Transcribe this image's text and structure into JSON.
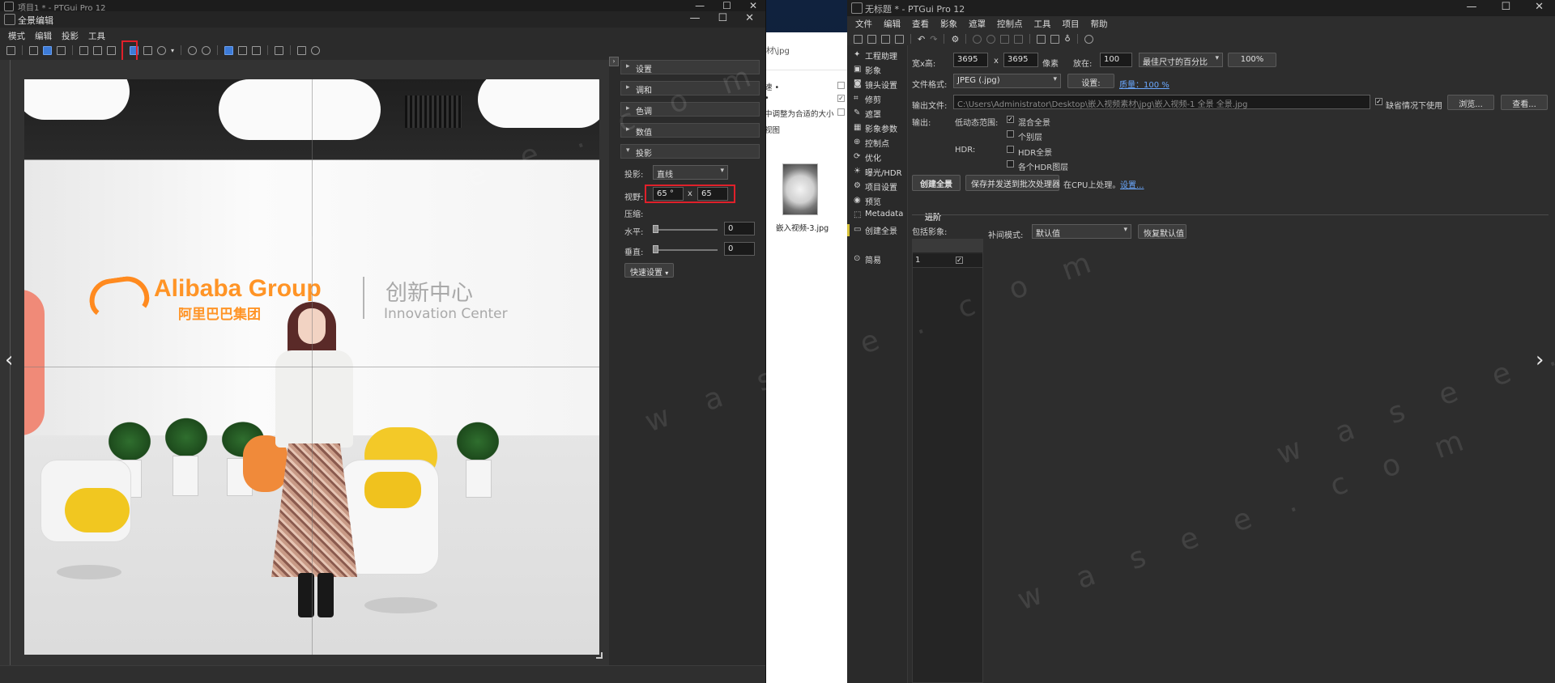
{
  "editor": {
    "project_title": "项目1 * - PTGui Pro 12",
    "title": "全景编辑",
    "menu": [
      "模式",
      "编辑",
      "投影",
      "工具"
    ],
    "panels": {
      "settings": "设置",
      "blend": "调和",
      "tone": "色调",
      "numeric": "数值",
      "projection": "投影"
    },
    "projection": {
      "label": "投影:",
      "value": "直线",
      "fov_label": "视野:",
      "fov_h": "65 °",
      "fov_sep": "x",
      "fov_v": "65",
      "compress_label": "压缩:",
      "horizontal_label": "水平:",
      "horizontal_value": "0",
      "vertical_label": "垂直:",
      "vertical_value": "0",
      "quick_button": "快速设置"
    }
  },
  "bg_window": {
    "path_text": "材\\jpg",
    "list_text_1": "速 •",
    "list_text_2": "•",
    "list_text_3": "中调整为合适的大小",
    "list_text_4": "视图",
    "thumb_label": "嵌入视频-3.jpg"
  },
  "main": {
    "title": "无标题 * - PTGui Pro 12",
    "menu": [
      "文件",
      "编辑",
      "查看",
      "影象",
      "遮罩",
      "控制点",
      "工具",
      "项目",
      "帮助"
    ],
    "nav": [
      "工程助理",
      "影象",
      "镜头设置",
      "修剪",
      "遮罩",
      "影象参数",
      "控制点",
      "优化",
      "曝光/HDR",
      "项目设置",
      "预览",
      "Metadata",
      "创建全景"
    ],
    "nav_simple": "简易",
    "size_label": "宽x高:",
    "width": "3695",
    "x": "x",
    "height": "3695",
    "pixels": "像素",
    "scale_label": "放在:",
    "scale_value": "100",
    "size_mode": "最佳尺寸的百分比",
    "percent_button": "100%",
    "format_label": "文件格式:",
    "format_value": "JPEG (.jpg)",
    "settings_button": "设置:",
    "quality_link": "质量：100 %",
    "output_file_label": "输出文件:",
    "output_path": "C:\\Users\\Administrator\\Desktop\\嵌入视频素材\\jpg\\嵌入视频-1 全景 全景.jpg",
    "default_use": "缺省情况下使用",
    "browse_button": "浏览...",
    "view_button": "查看...",
    "output_label": "输出:",
    "ldr_label": "低动态范围:",
    "blended": "混合全景",
    "layers": "个别层",
    "hdr_label": "HDR:",
    "hdr_pano": "HDR全景",
    "hdr_layers": "各个HDR图层",
    "create_button": "创建全景",
    "batch_button": "保存并发送到批次处理器",
    "cpu_text": "在CPU上处理。",
    "settings_link": "设置...",
    "advanced": "进阶",
    "include_label": "包括影象:",
    "interp_label": "补间模式:",
    "interp_value": "默认值",
    "restore_button": "恢复默认值",
    "table_row_1": "1"
  },
  "photo_text": {
    "logo_en": "Alibaba Group",
    "logo_cn": "阿里巴巴集团",
    "innov_cn": "创新中心",
    "innov_en": "Innovation Center"
  },
  "watermark": "w a s e e . c o m"
}
